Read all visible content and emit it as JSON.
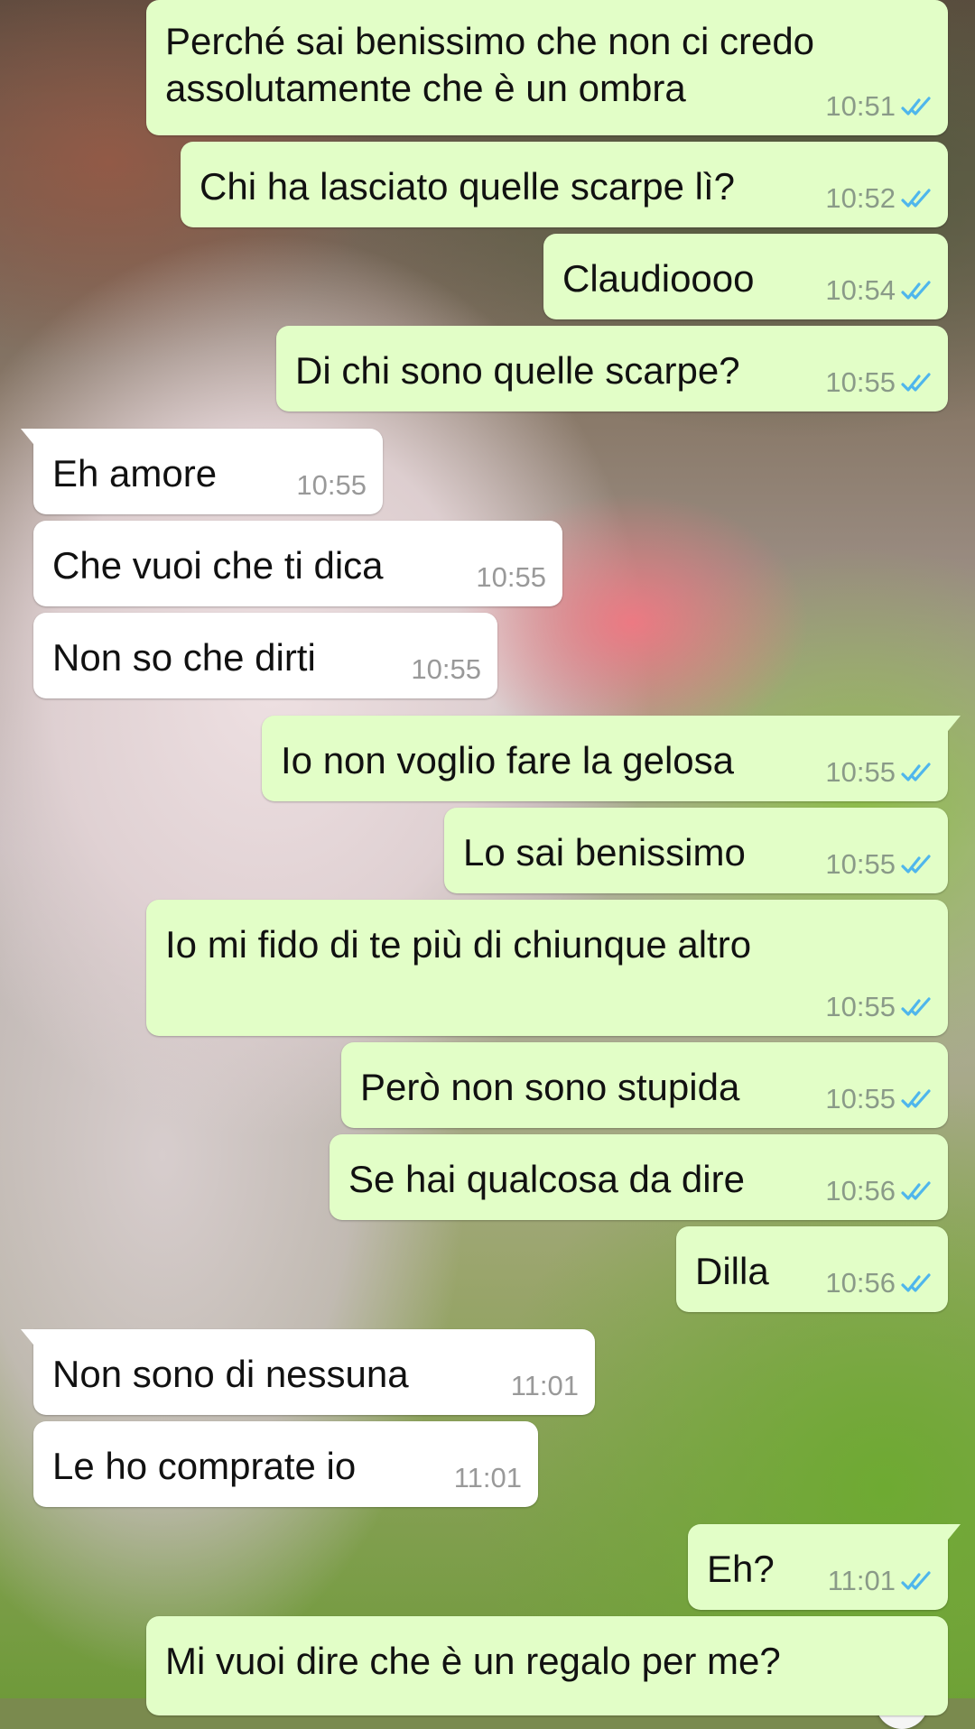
{
  "colors": {
    "outgoing_bubble": "#e2fec7",
    "incoming_bubble": "#ffffff",
    "read_ticks": "#4fb6ec"
  },
  "messages": [
    {
      "dir": "out",
      "text_lines": [
        "Perché sai benissimo che non ci credo",
        "assolutamente che è un ombra"
      ],
      "time": "10:51",
      "read": true
    },
    {
      "dir": "out",
      "text_lines": [
        "Chi ha lasciato quelle scarpe lì?"
      ],
      "time": "10:52",
      "read": true
    },
    {
      "dir": "out",
      "text_lines": [
        "Claudioooo"
      ],
      "time": "10:54",
      "read": true
    },
    {
      "dir": "out",
      "text_lines": [
        "Di chi sono quelle scarpe?"
      ],
      "time": "10:55",
      "read": true
    },
    {
      "dir": "in",
      "text_lines": [
        "Eh amore"
      ],
      "time": "10:55"
    },
    {
      "dir": "in",
      "text_lines": [
        "Che vuoi che ti dica"
      ],
      "time": "10:55"
    },
    {
      "dir": "in",
      "text_lines": [
        "Non so che dirti"
      ],
      "time": "10:55"
    },
    {
      "dir": "out",
      "text_lines": [
        "Io non voglio fare la gelosa"
      ],
      "time": "10:55",
      "read": true
    },
    {
      "dir": "out",
      "text_lines": [
        "Lo sai benissimo"
      ],
      "time": "10:55",
      "read": true
    },
    {
      "dir": "out",
      "text_lines": [
        "Io mi fido di te più di chiunque altro"
      ],
      "time": "10:55",
      "read": true
    },
    {
      "dir": "out",
      "text_lines": [
        "Però non sono stupida"
      ],
      "time": "10:55",
      "read": true
    },
    {
      "dir": "out",
      "text_lines": [
        "Se hai qualcosa da dire"
      ],
      "time": "10:56",
      "read": true
    },
    {
      "dir": "out",
      "text_lines": [
        "Dilla"
      ],
      "time": "10:56",
      "read": true
    },
    {
      "dir": "in",
      "text_lines": [
        "Non sono di nessuna"
      ],
      "time": "11:01"
    },
    {
      "dir": "in",
      "text_lines": [
        "Le ho comprate io"
      ],
      "time": "11:01"
    },
    {
      "dir": "out",
      "text_lines": [
        "Eh?"
      ],
      "time": "11:01",
      "read": true
    },
    {
      "dir": "out",
      "text_lines": [
        "Mi vuoi dire che è un regalo per me?"
      ],
      "time": "",
      "read": false
    }
  ]
}
